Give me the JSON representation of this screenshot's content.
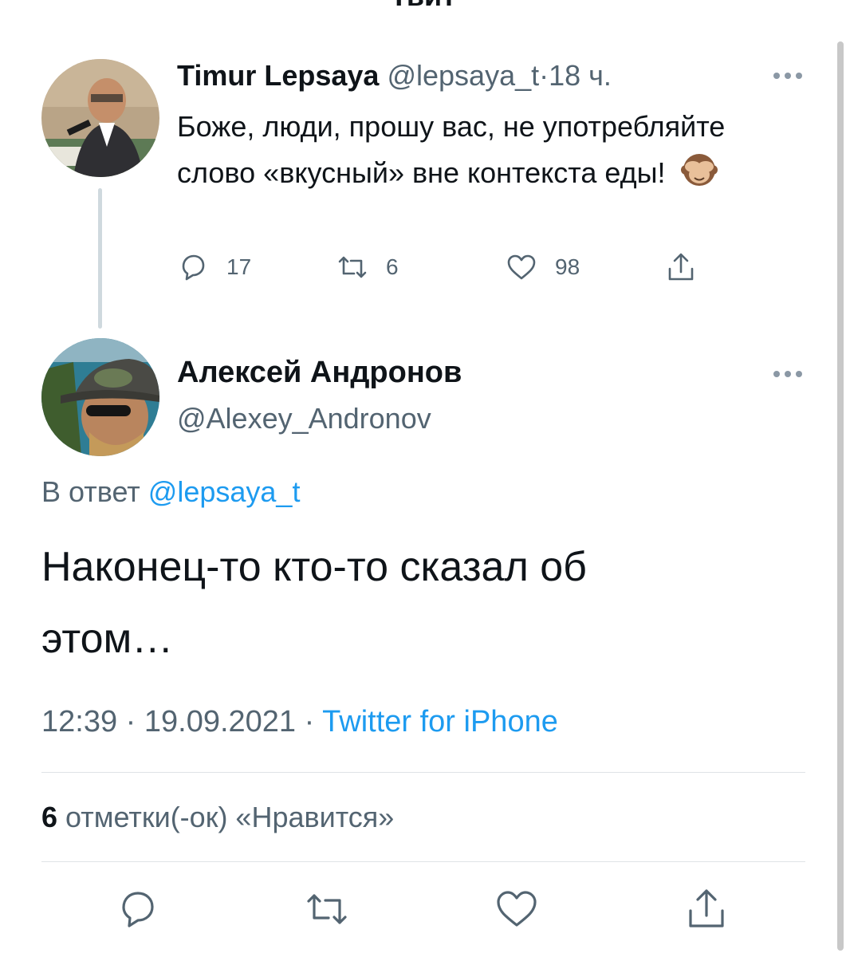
{
  "nav": {
    "title": "Твит"
  },
  "tweet1": {
    "author_name": "Timur Lepsaya",
    "handle": "@lepsaya_t",
    "separator": "·",
    "time": "18 ч.",
    "text": "Боже, люди, прошу вас, не употребляйте слово «вкусный» вне контекста еды!",
    "emoji": "see-no-evil-monkey",
    "reply_count": "17",
    "retweet_count": "6",
    "like_count": "98"
  },
  "tweet2": {
    "author_name": "Алексей Андронов",
    "handle": "@Alexey_Andronov",
    "reply_prefix": "В ответ",
    "reply_handle": "@lepsaya_t",
    "text_line1": "Наконец-то кто-то сказал об",
    "text_line2": "этом…",
    "time": "12:39",
    "sep1": "·",
    "date": "19.09.2021",
    "sep2": "·",
    "source": "Twitter for iPhone",
    "likes_count": "6",
    "likes_label": "отметки(-ок) «Нравится»"
  },
  "colors": {
    "text": "#0f1419",
    "secondary": "#536471",
    "link": "#1d9bf0",
    "divider": "#dfe3e6"
  }
}
